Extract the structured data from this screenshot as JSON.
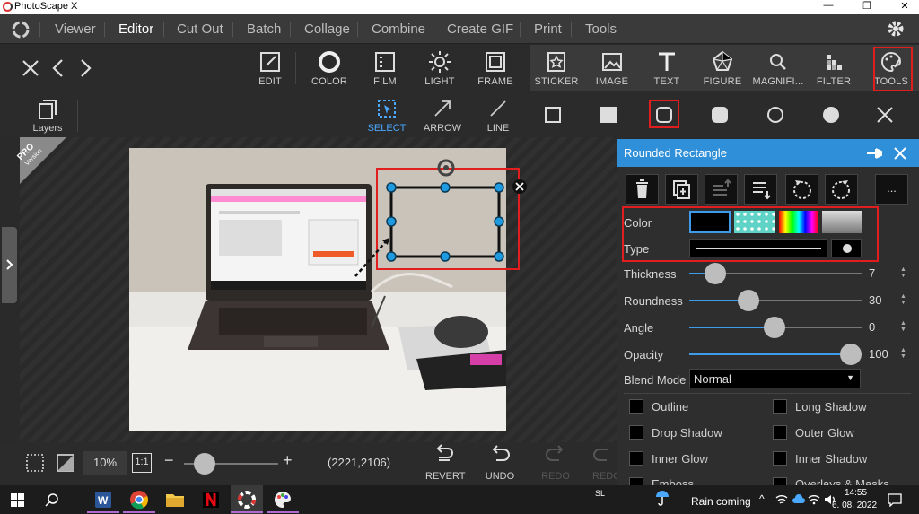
{
  "window": {
    "title": "PhotoScape X",
    "min": "—",
    "max": "❐",
    "close": "✕"
  },
  "menu": [
    "Viewer",
    "Editor",
    "Cut Out",
    "Batch",
    "Collage",
    "Combine",
    "Create GIF",
    "Print",
    "Tools"
  ],
  "menu_active": "Editor",
  "edit_tabs": {
    "edit": "EDIT",
    "color": "COLOR",
    "film": "FILM",
    "light": "LIGHT",
    "frame": "FRAME"
  },
  "right_tabs": {
    "sticker": "STICKER",
    "image": "IMAGE",
    "text": "TEXT",
    "figure": "FIGURE",
    "magnifier": "MAGNIFI...",
    "filter": "FILTER",
    "tools": "TOOLS"
  },
  "subtools": {
    "layers": "Layers",
    "select": "SELECT",
    "arrow": "ARROW",
    "line": "LINE"
  },
  "badge": {
    "pro": "PRO",
    "version": "Version"
  },
  "bottom": {
    "zoom": "10%",
    "ratio": "1:1",
    "minus": "−",
    "plus": "+",
    "coords": "(2221,2106)",
    "revert": "REVERT",
    "undo": "UNDO",
    "redo": "REDO",
    "redo2": "REDO",
    "zoom_level": 0.22
  },
  "panel": {
    "title": "Rounded Rectangle",
    "more": "...",
    "color_label": "Color",
    "type_label": "Type",
    "thickness_label": "Thickness",
    "thickness": "7",
    "thickness_pos": 0.11,
    "roundness_label": "Roundness",
    "roundness": "30",
    "roundness_pos": 0.33,
    "angle_label": "Angle",
    "angle": "0",
    "angle_pos": 0.5,
    "opacity_label": "Opacity",
    "opacity": "100",
    "opacity_pos": 1.0,
    "blend_label": "Blend Mode",
    "blend_value": "Normal",
    "checks": [
      "Outline",
      "Long Shadow",
      "Drop Shadow",
      "Outer Glow",
      "Inner Glow",
      "Inner Shadow",
      "Emboss",
      "Overlays & Masks"
    ]
  },
  "taskbar": {
    "lang": "SL",
    "weather": "Rain coming",
    "time": "14:55",
    "date": "6. 08. 2022"
  },
  "colors": {
    "accent": "#2f8fd8",
    "highlight": "#e21d1d",
    "handle": "#1e9be0"
  }
}
